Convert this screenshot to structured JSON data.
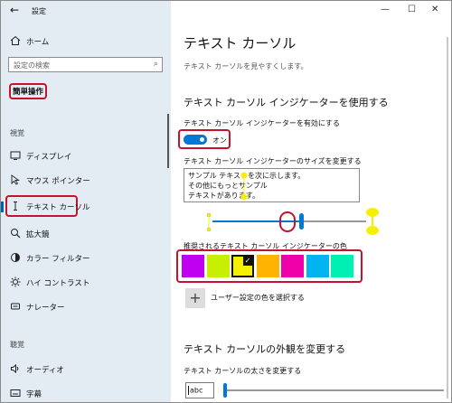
{
  "app_title": "設定",
  "sidebar": {
    "home_label": "ホーム",
    "search_placeholder": "設定の検索",
    "category": "簡単操作",
    "section_vision": "視覚",
    "section_hearing": "聴覚",
    "items": [
      {
        "label": "ディスプレイ"
      },
      {
        "label": "マウス ポインター"
      },
      {
        "label": "テキスト カーソル"
      },
      {
        "label": "拡大鏡"
      },
      {
        "label": "カラー フィルター"
      },
      {
        "label": "ハイ コントラスト"
      },
      {
        "label": "ナレーター"
      },
      {
        "label": "オーディオ"
      },
      {
        "label": "字幕"
      }
    ]
  },
  "main": {
    "title": "テキスト カーソル",
    "subtitle": "テキスト カーソルを見やすくします。",
    "indicator_heading": "テキスト カーソル インジケーターを使用する",
    "indicator_toggle_label": "テキスト カーソル インジケーターを有効にする",
    "toggle_state": "オン",
    "size_label": "テキスト カーソル インジケーターのサイズを変更する",
    "sample_lines": [
      "サンプル テキストを次に示します。",
      "その他にもっとサンプル",
      "テキストがあります。"
    ],
    "size_slider_level": 0.58,
    "colors_label": "推奨されるテキスト カーソル インジケーターの色",
    "colors": [
      "#c000f0",
      "#c6f000",
      "#f5f000",
      "#ffb400",
      "#f000a8",
      "#00b4f0",
      "#00f0b4"
    ],
    "selected_color_index": 2,
    "custom_color_label": "ユーザー設定の色を選択する",
    "appearance_heading": "テキスト カーソルの外観を変更する",
    "thickness_label": "テキスト カーソルの太さを変更する",
    "thickness_sample": "abc",
    "thickness_slider_level": 0.0
  },
  "accent_color": "#0078d7",
  "highlight_color": "#c4122f"
}
